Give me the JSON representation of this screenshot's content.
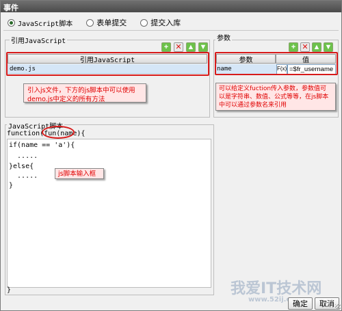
{
  "window": {
    "title": "事件"
  },
  "radios": [
    {
      "label": "JavaScript脚本",
      "selected": true
    },
    {
      "label": "表单提交",
      "selected": false
    },
    {
      "label": "提交入库",
      "selected": false
    }
  ],
  "left_panel": {
    "title": "引用JavaScript",
    "column_header": "引用JavaScript",
    "rows": [
      "demo.js"
    ],
    "annotation": "引入js文件，下方的js脚本中可以使用demo.js中定义的所有方法"
  },
  "right_panel": {
    "title": "参数",
    "columns": [
      "参数",
      "值"
    ],
    "row": {
      "name": "name",
      "formula_button": "F(x)",
      "value": "=$fr_username"
    },
    "annotation": "可以给定义fuction传入参数，参数值可以是字符串、数值、公式等等，在js脚本中可以通过参数名来引用"
  },
  "script_panel": {
    "title": "JavaScript脚本",
    "signature": "function(fun(name){",
    "code_lines": [
      "if(name == 'a'){",
      "  .....",
      "}else{",
      "  .....",
      "}"
    ],
    "closing_line": "}",
    "annotation": "js脚本输入框"
  },
  "toolbar_icons": [
    "add-icon",
    "delete-icon",
    "move-up-icon",
    "move-down-icon"
  ],
  "buttons": {
    "ok": "确定",
    "cancel": "取消"
  },
  "watermark": {
    "text": "我爱IT技术网",
    "sub": "www.52ij.com"
  },
  "colors": {
    "annotation_border": "#d71a1a",
    "annotation_text": "#e00000",
    "selection": "#d5e6f7"
  }
}
